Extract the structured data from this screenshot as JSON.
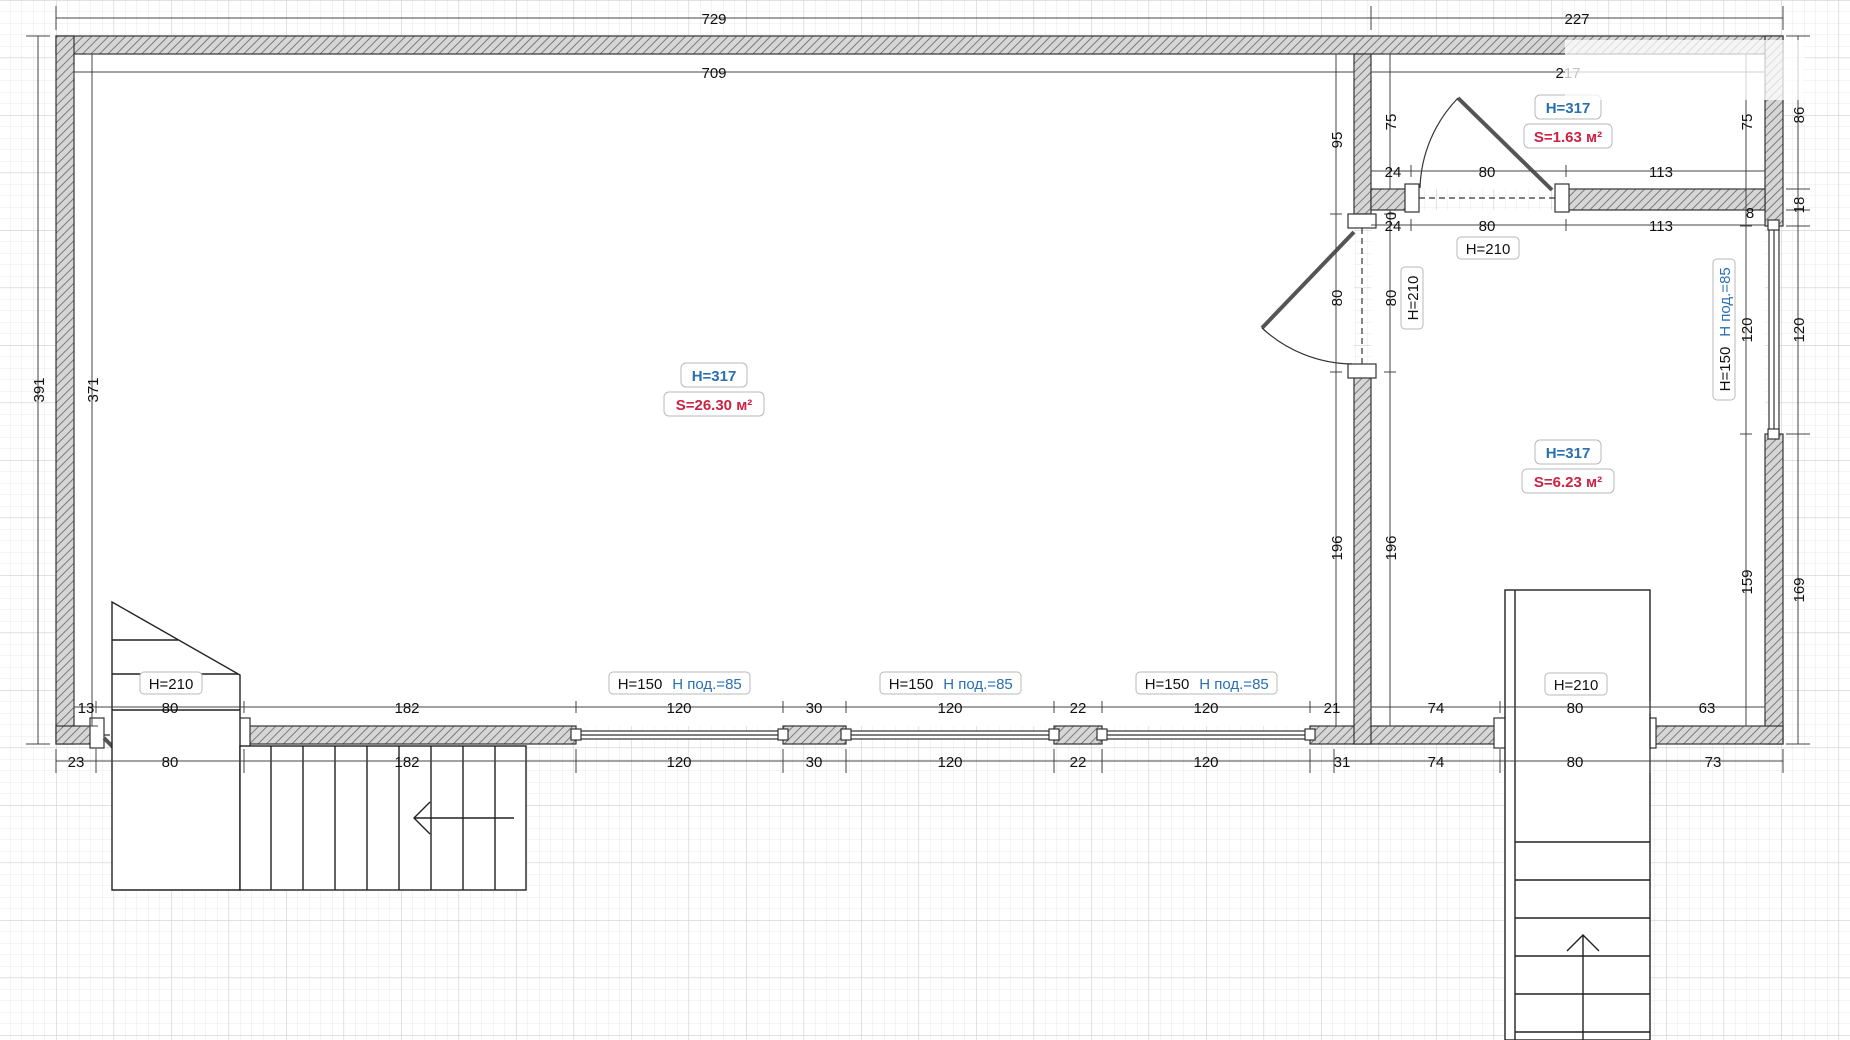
{
  "colors": {
    "wall_hatch": "#8a8a8a",
    "wall_stroke": "#333333",
    "grid_minor": "#e8e8e8",
    "grid_major": "#cfcfcf",
    "height_label": "#2a70b0",
    "area_label": "#cc2244",
    "tag_border": "#b8b8b8"
  },
  "rooms": [
    {
      "name": "main-room",
      "height_label": "H=317",
      "area_label": "S=26.30 м²"
    },
    {
      "name": "small-room",
      "height_label": "H=317",
      "area_label": "S=1.63 м²"
    },
    {
      "name": "hall-room",
      "height_label": "H=317",
      "area_label": "S=6.23 м²"
    }
  ],
  "doors": [
    {
      "label": "H=210"
    },
    {
      "label": "H=210"
    },
    {
      "label": "H=210"
    },
    {
      "label": "H=210"
    }
  ],
  "windows": [
    {
      "height": "H=150",
      "sill": "Н под.=85"
    },
    {
      "height": "H=150",
      "sill": "Н под.=85"
    },
    {
      "height": "H=150",
      "sill": "Н под.=85"
    },
    {
      "height": "H=150",
      "sill": "Н под.=85"
    }
  ],
  "dimensions": {
    "top_outer_left": "729",
    "top_outer_right": "227",
    "top_inner_main": "709",
    "top_inner_small": "217",
    "left_outer": "391",
    "left_inner": "371",
    "right_top": "86",
    "right_top_inner": "75",
    "right_mid_18": "18",
    "right_window": "120",
    "right_window_inner": "120",
    "right_bottom": "169",
    "right_bottom_inner": "159",
    "small_room_left": "75",
    "partition_top": "95",
    "partition_door": "80",
    "partition_door_right": "80",
    "partition_bottom": "196",
    "partition_bottom_right": "196",
    "zero_mark": "0",
    "small_room_8": "8",
    "small_wall_top": [
      "24",
      "80",
      "113"
    ],
    "small_wall_bottom": [
      "24",
      "80",
      "113"
    ],
    "bottom_inner": [
      "13",
      "80",
      "182",
      "120",
      "30",
      "120",
      "22",
      "120",
      "21",
      "74",
      "80",
      "63"
    ],
    "bottom_outer": [
      "23",
      "80",
      "182",
      "120",
      "30",
      "120",
      "22",
      "120",
      "31",
      "74",
      "80",
      "73"
    ]
  }
}
